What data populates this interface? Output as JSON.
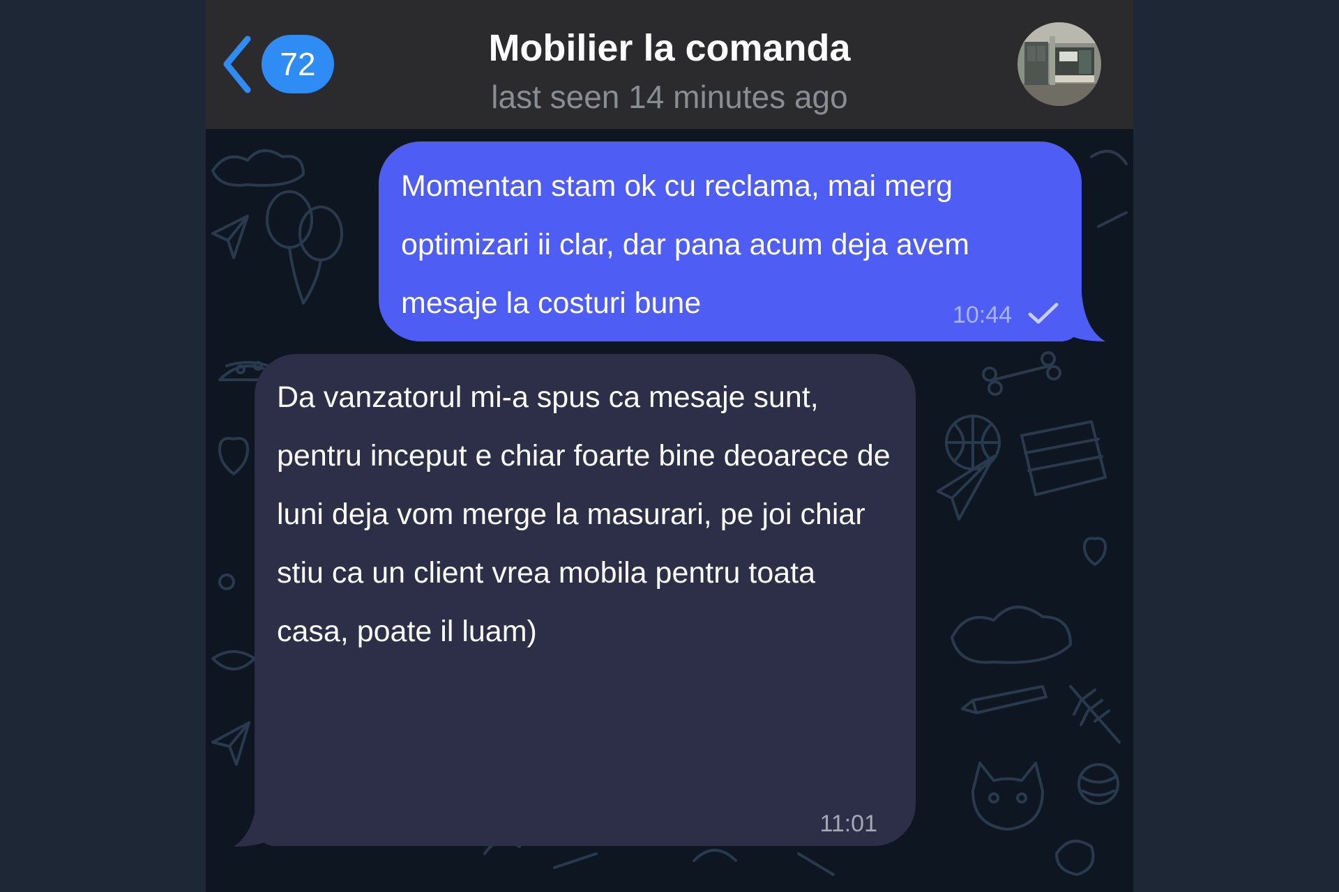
{
  "header": {
    "unread_count": "72",
    "title": "Mobilier la comanda",
    "status": "last seen 14 minutes ago",
    "back_icon": "chevron-left-icon",
    "avatar_icon": "contact-avatar-photo"
  },
  "messages": [
    {
      "direction": "outgoing",
      "text": "Momentan stam ok cu reclama, mai merg optimizari ii clar, dar pana acum deja avem mesaje la costuri bune",
      "time": "10:44",
      "status_icon": "single-check-icon"
    },
    {
      "direction": "incoming",
      "text": "Da vanzatorul mi-a spus ca mesaje sunt, pentru inceput e chiar foarte bine deoarece de luni deja vom merge la masurari, pe joi chiar stiu ca un client vrea mobila pentru toata casa, poate il luam)",
      "time": "11:01"
    }
  ],
  "colors": {
    "page_background": "#1d2735",
    "header_background": "#2b2b2d",
    "chat_background": "#0e1621",
    "accent": "#2f8cf5",
    "outgoing_bubble": "#4e5ef5",
    "incoming_bubble": "#2d2e48"
  }
}
